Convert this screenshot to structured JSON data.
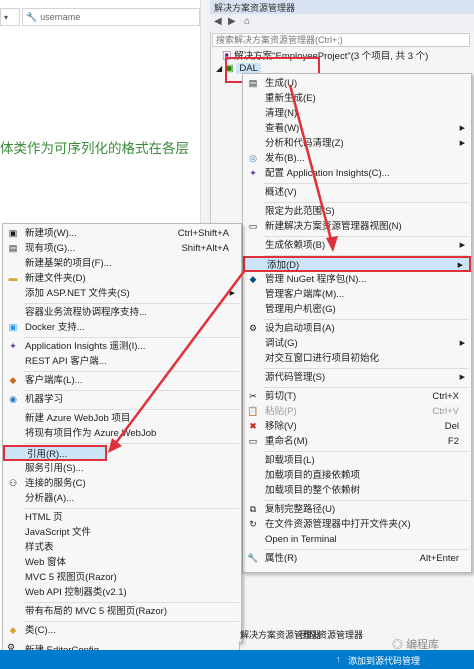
{
  "editor": {
    "member_dropdown_text": "username",
    "code_comment": "体类作为可序列化的格式在各层"
  },
  "solution_explorer": {
    "title": "解决方案资源管理器",
    "search_placeholder": "搜索解决方案资源管理器(Ctrl+;)",
    "solution_node": "解决方案\"EmployeeProject\"(3 个项目, 共 3 个)",
    "project_node": "DAL"
  },
  "project_menu": {
    "items": [
      {
        "label": "生成(U)",
        "icon": "build-icon"
      },
      {
        "label": "重新生成(E)"
      },
      {
        "label": "清理(N)"
      },
      {
        "label": "查看(W)",
        "submenu": true
      },
      {
        "label": "分析和代码清理(Z)",
        "submenu": true
      },
      {
        "label": "发布(B)...",
        "icon": "publish-icon"
      },
      {
        "label": "配置 Application Insights(C)...",
        "icon": "insights-icon"
      },
      {
        "label": "概述(V)"
      },
      {
        "label": "限定为此范围(S)"
      },
      {
        "label": "新建解决方案资源管理器视图(N)",
        "icon": "new-view-icon"
      },
      {
        "label": "生成依赖项(B)",
        "submenu": true
      },
      {
        "label": "添加(D)",
        "submenu": true
      },
      {
        "label": "管理 NuGet 程序包(N)...",
        "icon": "nuget-icon"
      },
      {
        "label": "管理客户端库(M)..."
      },
      {
        "label": "管理用户机密(G)"
      },
      {
        "label": "设为启动项目(A)",
        "icon": "gear-icon"
      },
      {
        "label": "调试(G)",
        "submenu": true
      },
      {
        "label": "对交互窗口进行项目初始化"
      },
      {
        "label": "源代码管理(S)",
        "submenu": true
      },
      {
        "label": "剪切(T)",
        "shortcut": "Ctrl+X",
        "icon": "cut-icon"
      },
      {
        "label": "粘贴(P)",
        "shortcut": "Ctrl+V",
        "icon": "paste-icon",
        "disabled": true
      },
      {
        "label": "移除(V)",
        "shortcut": "Del",
        "icon": "remove-icon"
      },
      {
        "label": "重命名(M)",
        "shortcut": "F2",
        "icon": "rename-icon"
      },
      {
        "label": "卸载项目(L)"
      },
      {
        "label": "加载项目的直接依赖项"
      },
      {
        "label": "加载项目的整个依赖树"
      },
      {
        "label": "复制完整路径(U)",
        "icon": "copy-icon"
      },
      {
        "label": "在文件资源管理器中打开文件夹(X)",
        "icon": "open-folder-icon"
      },
      {
        "label": "Open in Terminal"
      },
      {
        "label": "属性(R)",
        "shortcut": "Alt+Enter",
        "icon": "wrench-icon"
      }
    ]
  },
  "add_menu": {
    "items": [
      {
        "label": "新建项(W)...",
        "shortcut": "Ctrl+Shift+A",
        "icon": "new-item-icon"
      },
      {
        "label": "现有项(G)...",
        "shortcut": "Shift+Alt+A",
        "icon": "existing-item-icon"
      },
      {
        "label": "新建基架的项目(F)..."
      },
      {
        "label": "新建文件夹(D)",
        "icon": "new-folder-icon"
      },
      {
        "label": "添加 ASP.NET 文件夹(S)",
        "submenu": true
      },
      {
        "label": "容器业务流程协调程序支持..."
      },
      {
        "label": "Docker 支持...",
        "icon": "docker-icon"
      },
      {
        "label": "Application Insights 遥测(I)...",
        "icon": "insights-icon"
      },
      {
        "label": "REST API 客户端..."
      },
      {
        "label": "客户端库(L)...",
        "icon": "client-lib-icon"
      },
      {
        "label": "机器学习",
        "icon": "ml-icon"
      },
      {
        "label": "新建 Azure WebJob 项目"
      },
      {
        "label": "将现有项目作为 Azure WebJob"
      },
      {
        "label": "引用(R)..."
      },
      {
        "label": "服务引用(S)..."
      },
      {
        "label": "连接的服务(C)",
        "icon": "connected-services-icon"
      },
      {
        "label": "分析器(A)..."
      },
      {
        "label": "HTML 页"
      },
      {
        "label": "JavaScript 文件"
      },
      {
        "label": "样式表"
      },
      {
        "label": "Web 窗体"
      },
      {
        "label": "MVC 5 视图页(Razor)"
      },
      {
        "label": "Web API 控制器类(v2.1)"
      },
      {
        "label": "带有布局的 MVC 5 视图页(Razor)"
      },
      {
        "label": "类(C)...",
        "icon": "class-icon"
      },
      {
        "label": "新建 EditorConfig",
        "icon": "editorconfig-icon"
      }
    ]
  },
  "bottom_tabs": {
    "tab1": "解决方案资源管理器",
    "tab2": "团队资源管理器"
  },
  "statusbar": {
    "right_text": "添加到源代码管理"
  },
  "watermark": "编程库"
}
